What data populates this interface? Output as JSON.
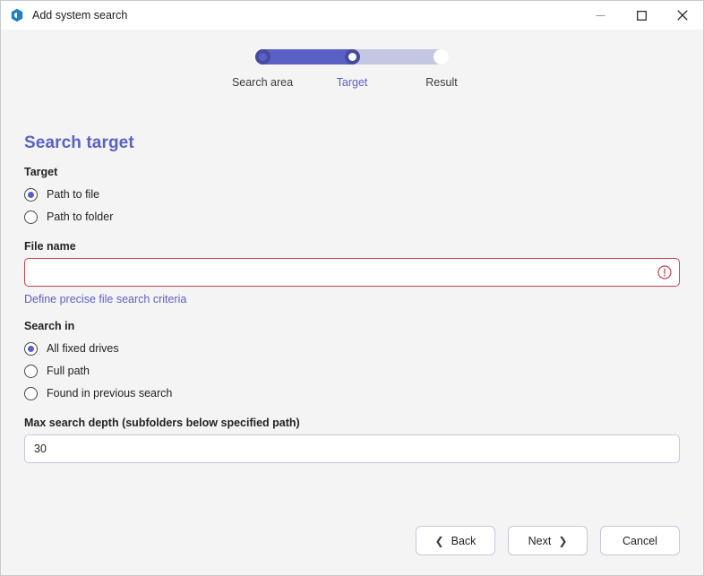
{
  "window": {
    "title": "Add system search",
    "app_icon": "app-logo-icon",
    "controls": {
      "minimize": "minimize-icon",
      "maximize": "maximize-icon",
      "close": "close-icon"
    }
  },
  "stepper": {
    "steps": [
      {
        "label": "Search area",
        "state": "done"
      },
      {
        "label": "Target",
        "state": "current"
      },
      {
        "label": "Result",
        "state": "todo"
      }
    ],
    "fill_percent": 50,
    "colors": {
      "fill": "#5b61c4",
      "track": "#c3c7e4",
      "node_ring": "#464b9e",
      "active_label": "#5b61c4"
    }
  },
  "page": {
    "title": "Search target"
  },
  "target": {
    "label": "Target",
    "options": [
      {
        "label": "Path to file",
        "checked": true
      },
      {
        "label": "Path to folder",
        "checked": false
      }
    ]
  },
  "file_name": {
    "label": "File name",
    "value": "",
    "placeholder": "",
    "has_error": true,
    "error_icon": "error-exclamation-icon",
    "error_color": "#c7444a",
    "link_text": "Define precise file search criteria"
  },
  "search_in": {
    "label": "Search in",
    "options": [
      {
        "label": "All fixed drives",
        "checked": true
      },
      {
        "label": "Full path",
        "checked": false
      },
      {
        "label": "Found in previous search",
        "checked": false
      }
    ]
  },
  "max_depth": {
    "label": "Max search depth (subfolders below specified path)",
    "value": "30",
    "placeholder": ""
  },
  "footer": {
    "back_label": "Back",
    "back_icon": "chevron-left-icon",
    "next_label": "Next",
    "next_icon": "chevron-right-icon",
    "cancel_label": "Cancel"
  }
}
